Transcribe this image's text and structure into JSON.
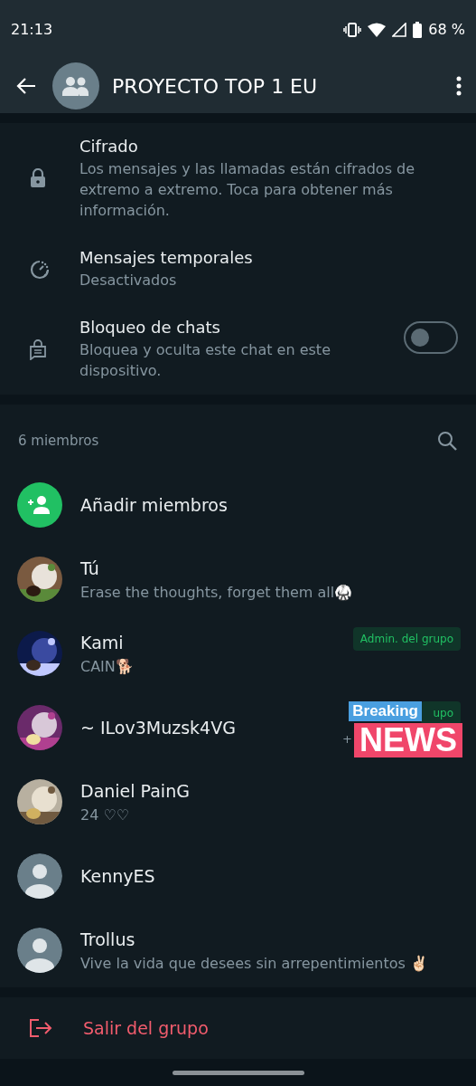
{
  "status_bar": {
    "time": "21:13",
    "battery": "68 %"
  },
  "app_bar": {
    "title": "PROYECTO TOP 1 EU"
  },
  "settings": [
    {
      "kind": "lock",
      "title": "Cifrado",
      "subtitle": "Los mensajes y las llamadas están cifrados de extremo a extremo. Toca para obtener más información."
    },
    {
      "kind": "timer",
      "title": "Mensajes temporales",
      "subtitle": "Desactivados"
    },
    {
      "kind": "chatlock",
      "title": "Bloqueo de chats",
      "subtitle": "Bloquea y oculta este chat en este dispositivo.",
      "on": false
    }
  ],
  "members_header": "6 miembros",
  "add_members": "Añadir miembros",
  "members": [
    {
      "kind": "picture",
      "name": "Tú",
      "about": "Erase the thoughts, forget them all🥋"
    },
    {
      "kind": "picture",
      "name": "Kami",
      "about": "CAIN🐕",
      "badge": "Admin. del grupo"
    },
    {
      "kind": "picture",
      "name": "~ ILov3Muzsk4VG",
      "badge": "upo",
      "phone": "+"
    },
    {
      "kind": "picture",
      "name": "Daniel PainG",
      "about": "24 ♡♡"
    },
    {
      "kind": "default",
      "name": "KennyES"
    },
    {
      "kind": "default",
      "name": "Trollus",
      "about": "Vive la vida que desees sin arrepentimientos ✌🏻"
    }
  ],
  "sticker": {
    "line_1": "Breaking",
    "line_2": "NEWS"
  },
  "exit": "Salir del grupo"
}
